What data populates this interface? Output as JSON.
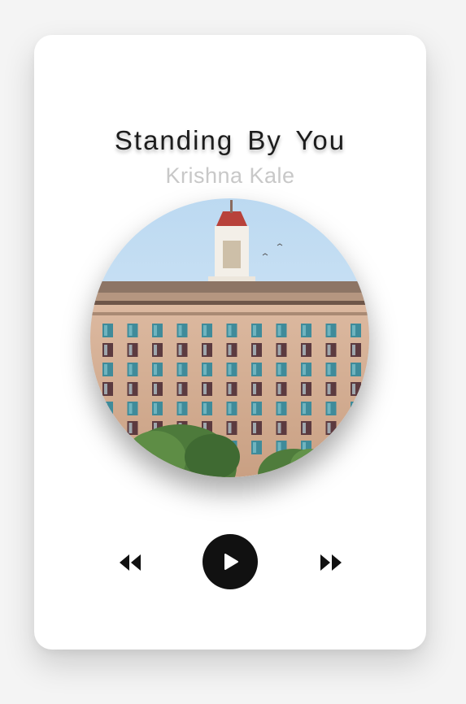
{
  "player": {
    "title": "Standing By You",
    "artist": "Krishna Kale",
    "cover_image": "building-clock-tower-album-art"
  },
  "controls": {
    "previous_icon": "rewind-icon",
    "play_icon": "play-icon",
    "next_icon": "fast-forward-icon"
  },
  "colors": {
    "background": "#f4f4f4",
    "card": "#ffffff",
    "title": "#1c1c1c",
    "artist": "#c8c8c8",
    "play_button": "#111111"
  }
}
